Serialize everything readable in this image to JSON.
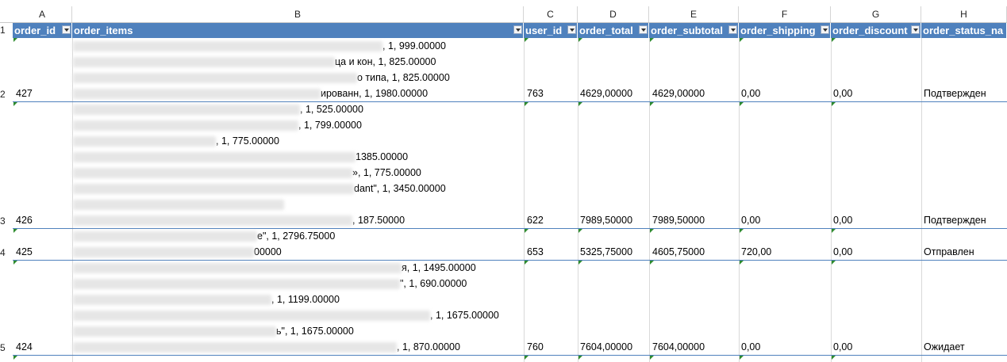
{
  "columns": [
    "A",
    "B",
    "C",
    "D",
    "E",
    "F",
    "G",
    "H"
  ],
  "headers": [
    "order_id",
    "order_items",
    "user_id",
    "order_total",
    "order_subtotal",
    "order_shipping",
    "order_discount",
    "order_status_na"
  ],
  "header_row_number": "1",
  "rows": [
    {
      "row_number": "2",
      "order_id": "427",
      "items": [
        ", 1, 999.00000",
        "ца и кон, 1, 825.00000",
        "о типа, 1, 825.00000",
        "ированн, 1, 1980.00000"
      ],
      "user_id": "763",
      "order_total": "4629,00000",
      "order_subtotal": "4629,00000",
      "order_shipping": "0,00",
      "order_discount": "0,00",
      "status": "Подтвержден"
    },
    {
      "row_number": "3",
      "order_id": "426",
      "items": [
        ", 1, 525.00000",
        ", 1, 799.00000",
        ", 1, 775.00000",
        "1385.00000",
        "», 1, 775.00000",
        "dant\", 1, 3450.00000",
        "",
        ", 187.50000"
      ],
      "user_id": "622",
      "order_total": "7989,50000",
      "order_subtotal": "7989,50000",
      "order_shipping": "0,00",
      "order_discount": "0,00",
      "status": "Подтвержден"
    },
    {
      "row_number": "4",
      "order_id": "425",
      "items": [
        "e\", 1, 2796.75000",
        "00000"
      ],
      "user_id": "653",
      "order_total": "5325,75000",
      "order_subtotal": "4605,75000",
      "order_shipping": "720,00",
      "order_discount": "0,00",
      "status": "Отправлен"
    },
    {
      "row_number": "5",
      "order_id": "424",
      "items": [
        "я, 1, 1495.00000",
        "\", 1, 690.00000",
        ", 1, 1199.00000",
        ", 1, 1675.00000",
        "ь\", 1, 1675.00000",
        ", 1, 870.00000"
      ],
      "user_id": "760",
      "order_total": "7604,00000",
      "order_subtotal": "7604,00000",
      "order_shipping": "0,00",
      "order_discount": "0,00",
      "status": "Ожидает"
    }
  ]
}
